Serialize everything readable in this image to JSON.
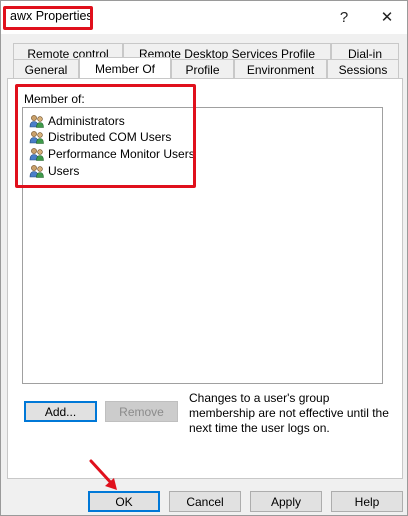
{
  "window": {
    "title": "awx Properties",
    "help_glyph": "?",
    "close_glyph": "✕"
  },
  "tabs": {
    "row1": [
      "Remote control",
      "Remote Desktop Services Profile",
      "Dial-in"
    ],
    "row2": [
      "General",
      "Member Of",
      "Profile",
      "Environment",
      "Sessions"
    ],
    "active": "Member Of"
  },
  "member_of": {
    "label": "Member of:",
    "groups": [
      "Administrators",
      "Distributed COM Users",
      "Performance Monitor Users",
      "Users"
    ]
  },
  "actions": {
    "add_label": "Add...",
    "remove_label": "Remove",
    "note": "Changes to a user's group membership are not effective until the next time the user logs on."
  },
  "footer": {
    "ok_label": "OK",
    "cancel_label": "Cancel",
    "apply_label": "Apply",
    "help_label": "Help"
  },
  "colors": {
    "highlight_red": "#e0101c",
    "focus_blue": "#0078d7"
  },
  "icons": [
    "help-icon",
    "close-icon",
    "group-icon",
    "annotation-arrow-icon"
  ]
}
